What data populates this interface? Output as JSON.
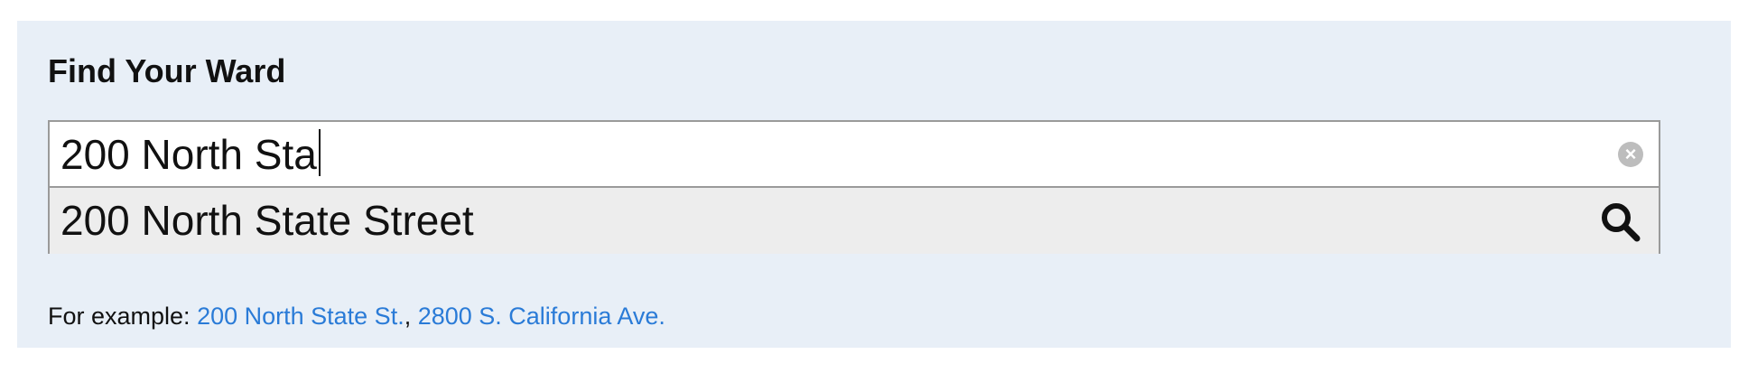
{
  "widget": {
    "title": "Find Your Ward"
  },
  "search": {
    "value": "200 North Sta",
    "clear_symbol": "×",
    "clear_icon": "clear-circle-icon",
    "submit_icon": "search-icon",
    "suggestion": "200 North State Street"
  },
  "examples": {
    "prefix": "For example: ",
    "separator": ", ",
    "links": [
      "200 North State St.",
      "2800 S. California Ave."
    ]
  },
  "colors": {
    "panel_background": "#e8eff7",
    "link": "#2a7bd7",
    "suggestion_background": "#ededed",
    "border": "#9a9a9a"
  }
}
